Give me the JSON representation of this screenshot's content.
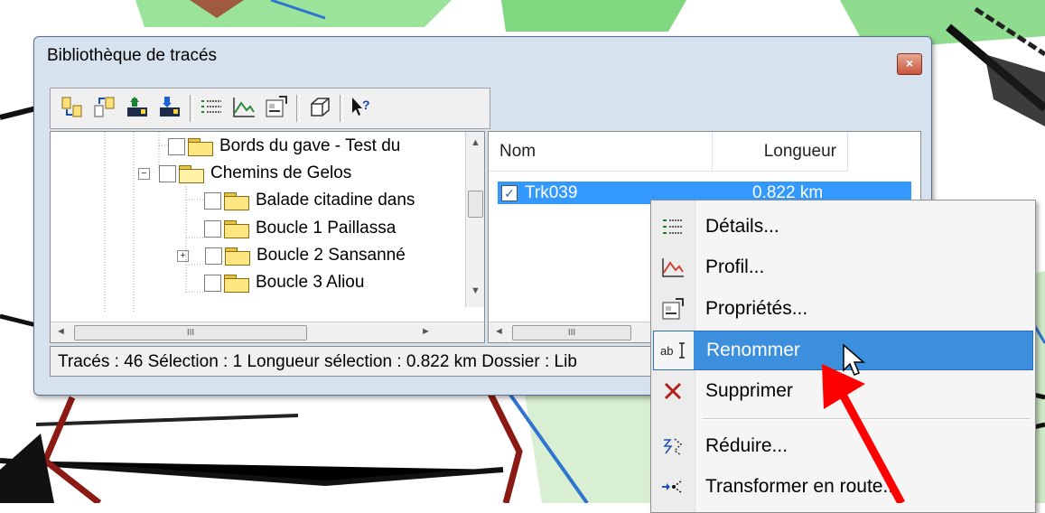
{
  "window": {
    "title": "Bibliothèque de tracés",
    "close_label": "×"
  },
  "toolbar": {
    "buttons": [
      "import-icon",
      "export-icon",
      "upload-to-gps-icon",
      "download-from-gps-icon",
      "details-icon",
      "profile-icon",
      "properties-icon",
      "3d-view-icon",
      "help-icon"
    ]
  },
  "tree": {
    "items": [
      {
        "label": "Bords du gave - Test du",
        "expanded": false
      },
      {
        "label": "Chemins de Gelos",
        "expanded": true,
        "expander": "−"
      },
      {
        "label": "Balade citadine dans"
      },
      {
        "label": "Boucle 1 Paillassa"
      },
      {
        "label": "Boucle 2 Sansanné",
        "expander": "+"
      },
      {
        "label": "Boucle 3 Aliou"
      }
    ],
    "scroll_thumb_label": "III"
  },
  "list": {
    "columns": {
      "name": "Nom",
      "length": "Longueur"
    },
    "rows": [
      {
        "checked": true,
        "name": "Trk039",
        "length": "0.822 km"
      }
    ],
    "scroll_thumb_label": "III"
  },
  "status": {
    "text": "Tracés : 46 Sélection : 1 Longueur sélection : 0.822 km Dossier : Lib"
  },
  "context_menu": {
    "items": [
      {
        "label": "Détails...",
        "icon": "details-icon"
      },
      {
        "label": "Profil...",
        "icon": "profile-icon"
      },
      {
        "label": "Propriétés...",
        "icon": "properties-icon"
      },
      {
        "label": "Renommer",
        "icon": "rename-icon",
        "highlighted": true
      },
      {
        "label": "Supprimer",
        "icon": "delete-icon"
      },
      {
        "label": "Réduire...",
        "icon": "reduce-icon"
      },
      {
        "label": "Transformer en route...",
        "icon": "convert-to-route-icon"
      }
    ]
  },
  "colors": {
    "selection": "#3399ff",
    "menu_highlight": "#3b8fdc",
    "annotation_arrow": "#ff0000"
  }
}
